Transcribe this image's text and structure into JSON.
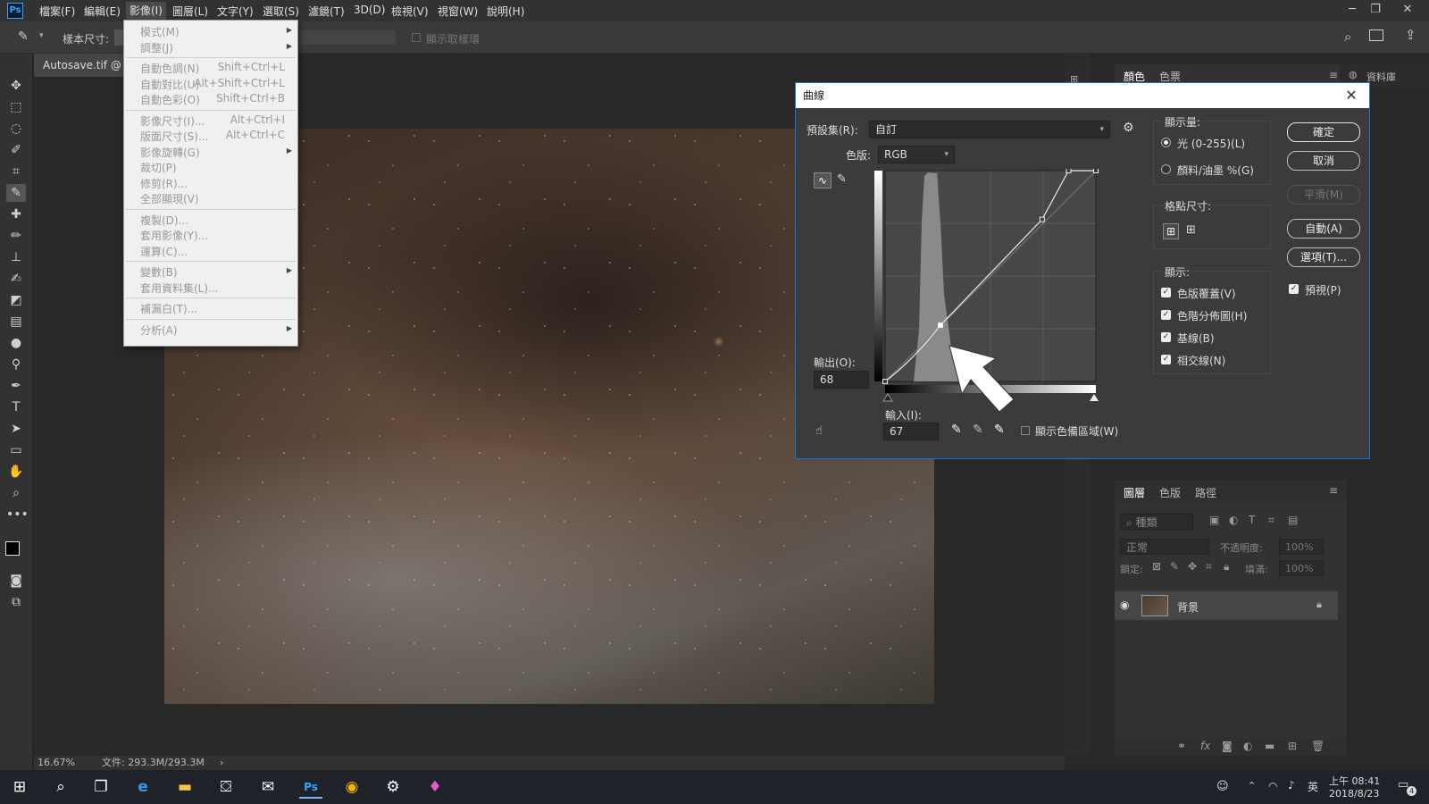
{
  "menubar": {
    "logo": "Ps",
    "items": [
      "檔案(F)",
      "編輯(E)",
      "影像(I)",
      "圖層(L)",
      "文字(Y)",
      "選取(S)",
      "濾鏡(T)",
      "3D(D)",
      "檢視(V)",
      "視窗(W)",
      "說明(H)"
    ],
    "active_index": 2,
    "window_controls": [
      "─",
      "❐",
      "✕"
    ]
  },
  "optionsbar": {
    "sample_size_label": "樣本尺寸:",
    "show_sampling_ring": "顯示取樣環"
  },
  "document": {
    "tab_title": "Autosave.tif @ 16.",
    "zoom": "16.67%",
    "file_info": "文件: 293.3M/293.3M"
  },
  "image_menu": {
    "items": [
      {
        "label": "模式(M)",
        "shortcut": "",
        "submenu": true
      },
      {
        "label": "調整(J)",
        "shortcut": "",
        "submenu": true
      },
      {
        "label": "自動色調(N)",
        "shortcut": "Shift+Ctrl+L",
        "submenu": false
      },
      {
        "label": "自動對比(U)",
        "shortcut": "Alt+Shift+Ctrl+L",
        "submenu": false
      },
      {
        "label": "自動色彩(O)",
        "shortcut": "Shift+Ctrl+B",
        "submenu": false
      },
      {
        "label": "影像尺寸(I)...",
        "shortcut": "Alt+Ctrl+I",
        "submenu": false
      },
      {
        "label": "版面尺寸(S)...",
        "shortcut": "Alt+Ctrl+C",
        "submenu": false
      },
      {
        "label": "影像旋轉(G)",
        "shortcut": "",
        "submenu": true
      },
      {
        "label": "裁切(P)",
        "shortcut": "",
        "submenu": false
      },
      {
        "label": "修剪(R)...",
        "shortcut": "",
        "submenu": false
      },
      {
        "label": "全部顯現(V)",
        "shortcut": "",
        "submenu": false
      },
      {
        "label": "複製(D)...",
        "shortcut": "",
        "submenu": false
      },
      {
        "label": "套用影像(Y)...",
        "shortcut": "",
        "submenu": false
      },
      {
        "label": "運算(C)...",
        "shortcut": "",
        "submenu": false
      },
      {
        "label": "變數(B)",
        "shortcut": "",
        "submenu": true
      },
      {
        "label": "套用資料集(L)...",
        "shortcut": "",
        "submenu": false
      },
      {
        "label": "補漏白(T)...",
        "shortcut": "",
        "submenu": false
      },
      {
        "label": "分析(A)",
        "shortcut": "",
        "submenu": true
      }
    ]
  },
  "curves": {
    "title": "曲線",
    "preset_label": "預設集(R):",
    "preset_value": "自訂",
    "channel_label": "色版:",
    "channel_value": "RGB",
    "output_label": "輸出(O):",
    "output_value": "68",
    "input_label": "輸入(I):",
    "input_value": "67",
    "show_clipping": "顯示色備區域(W)",
    "display_amount": {
      "title": "顯示量:",
      "options": [
        "光 (0-255)(L)",
        "顏料/油墨 %(G)"
      ],
      "selected": 0
    },
    "grid_size_title": "格點尺寸:",
    "show": {
      "title": "顯示:",
      "options": [
        "色版覆蓋(V)",
        "色階分佈圖(H)",
        "基線(B)",
        "相交線(N)"
      ]
    },
    "buttons": {
      "ok": "確定",
      "cancel": "取消",
      "smooth": "平滑(M)",
      "auto": "自動(A)",
      "options": "選項(T)...",
      "preview": "預視(P)"
    },
    "curve_points": [
      [
        0,
        0
      ],
      [
        67,
        68
      ],
      [
        190,
        196
      ],
      [
        222,
        255
      ],
      [
        255,
        255
      ]
    ]
  },
  "right_panels": {
    "top_tabs": [
      "顏色",
      "色票"
    ],
    "side_label": "資料庫",
    "layers_tabs": [
      "圖層",
      "色版",
      "路徑"
    ],
    "kind_placeholder": "種類",
    "blend_mode": "正常",
    "opacity_label": "不透明度:",
    "opacity_value": "100%",
    "lock_label": "鎖定:",
    "fill_label": "填滿:",
    "fill_value": "100%",
    "layer_name": "背景"
  },
  "taskbar": {
    "time": "上午 08:41",
    "date": "2018/8/23",
    "ime": "英",
    "notifications": "4"
  }
}
